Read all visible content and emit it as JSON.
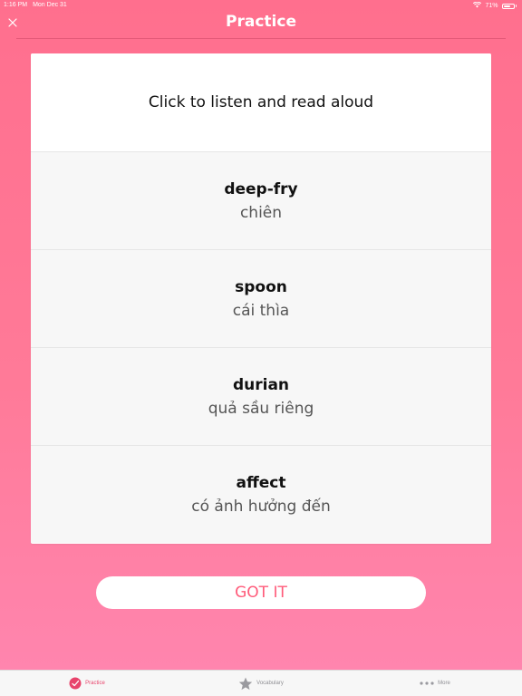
{
  "status_bar": {
    "time": "1:16 PM",
    "date": "Mon Dec 31",
    "battery": "71%",
    "battery_level": 0.71
  },
  "header": {
    "title": "Practice"
  },
  "card": {
    "instruction": "Click to listen and read aloud",
    "words": [
      {
        "term": "deep-fry",
        "translation": "chiên"
      },
      {
        "term": "spoon",
        "translation": "cái thìa"
      },
      {
        "term": "durian",
        "translation": "quả sầu riêng"
      },
      {
        "term": "affect",
        "translation": "có ảnh hưởng đến"
      }
    ]
  },
  "got_it_label": "GOT IT",
  "tab_bar": {
    "tabs": [
      {
        "label": "Practice",
        "icon": "practice-icon",
        "active": true
      },
      {
        "label": "Vocabulary",
        "icon": "star-icon",
        "active": false
      },
      {
        "label": "More",
        "icon": "more-icon",
        "active": false
      }
    ]
  },
  "colors": {
    "accent": "#e8436b",
    "button_text": "#ff5b7a",
    "background_top": "#ff6f8e",
    "background_bottom": "#ff86b0"
  }
}
